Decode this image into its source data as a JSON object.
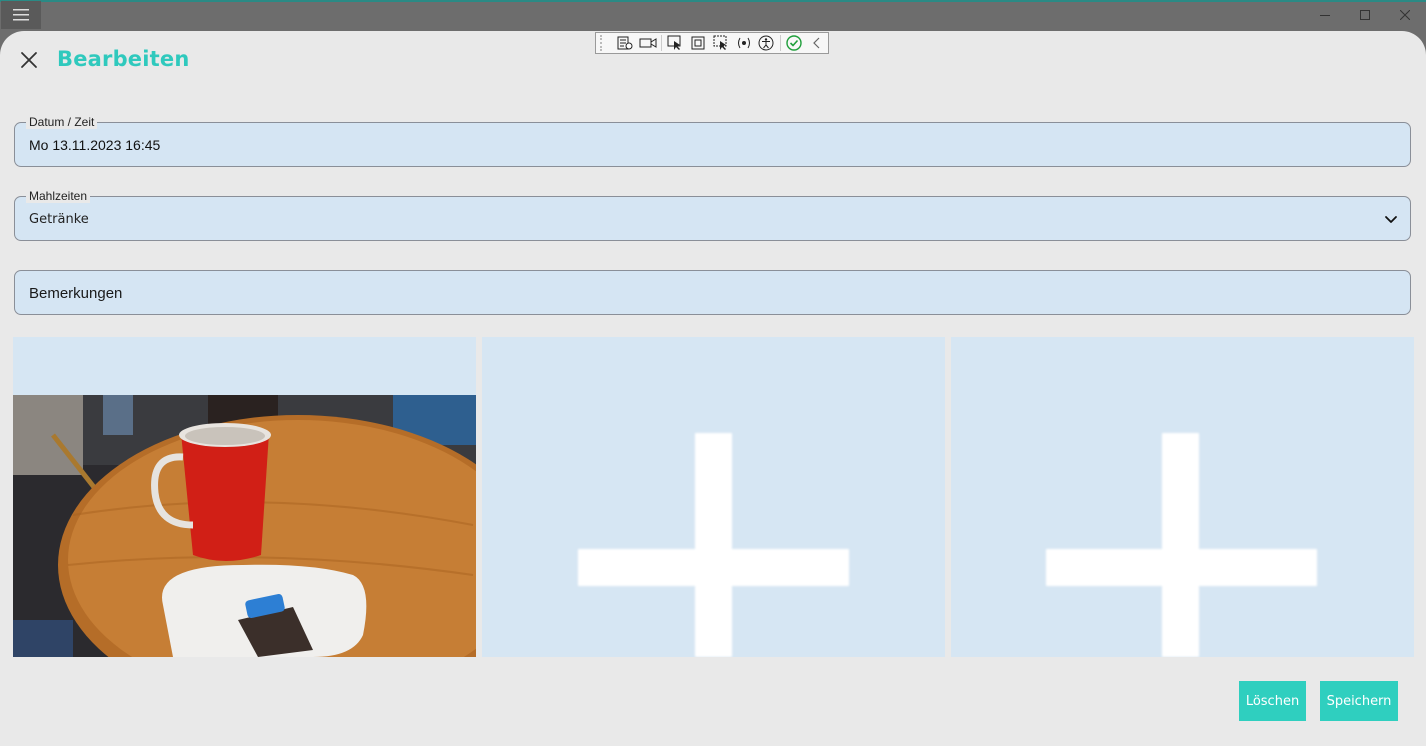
{
  "window": {
    "menu_icon": "hamburger-icon",
    "minimize_icon": "minimize-icon",
    "maximize_icon": "maximize-icon",
    "close_icon": "close-icon"
  },
  "dialog": {
    "title": "Bearbeiten",
    "close_icon": "close-icon"
  },
  "devtools": {
    "icons": [
      "live-tree-icon",
      "record-icon",
      "select-element-icon",
      "display-layout-icon",
      "track-focus-icon",
      "binding-failures-icon",
      "accessibility-icon",
      "checkmark-icon",
      "collapse-chevron-icon"
    ]
  },
  "form": {
    "datetime": {
      "label": "Datum / Zeit",
      "value": "Mo 13.11.2023 16:45"
    },
    "meal": {
      "label": "Mahlzeiten",
      "value": "Getränke"
    },
    "remarks": {
      "placeholder": "Bemerkungen"
    }
  },
  "images": {
    "slot1": "photo-of-red-mug-on-table",
    "slot2": "add-image-plus-icon",
    "slot3": "add-image-plus-icon"
  },
  "actions": {
    "delete_label": "Löschen",
    "save_label": "Speichern"
  },
  "colors": {
    "accent": "#2fcfbf",
    "title": "#2fc9bd",
    "field_bg": "#d5e5f3",
    "dialog_bg": "#e9e9e9"
  }
}
